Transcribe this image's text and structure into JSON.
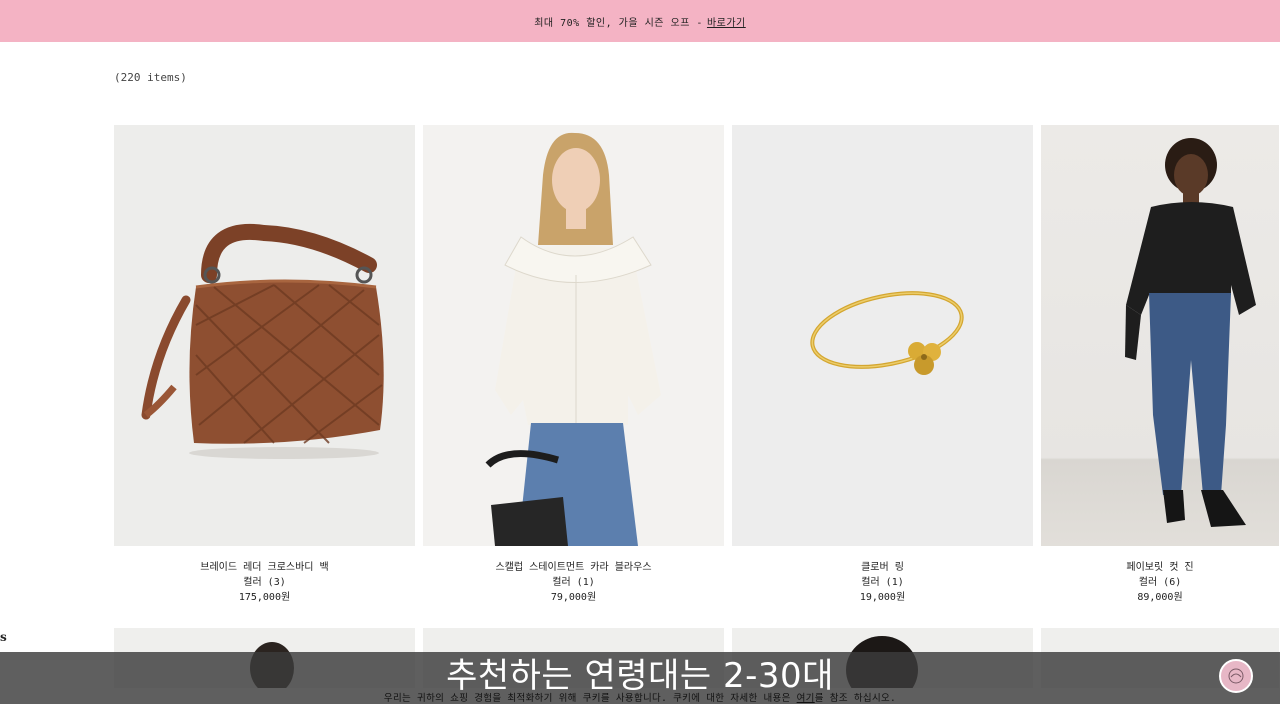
{
  "promo": {
    "text": "최대 70% 할인, 가을 시즌 오프 -",
    "link_label": " 바로가기"
  },
  "listing": {
    "item_count": "(220 items)"
  },
  "edge_glyph": "s",
  "products": [
    {
      "name": "브레이드 레더 크로스바디 백",
      "colors": "컬러 (3)",
      "price": "175,000원",
      "image_icon": "handbag-image"
    },
    {
      "name": "스캘럽 스테이트먼트 카라 블라우스",
      "colors": "컬러 (1)",
      "price": "79,000원",
      "image_icon": "blouse-model-image"
    },
    {
      "name": "클로버 링",
      "colors": "컬러 (1)",
      "price": "19,000원",
      "image_icon": "ring-image"
    },
    {
      "name": "페이보릿 컷 진",
      "colors": "컬러 (6)",
      "price": "89,000원",
      "image_icon": "jeans-model-image"
    }
  ],
  "subtitle": "추천하는 연령대는 2-30대",
  "cookie_notice": {
    "text": "우리는 귀하의 쇼핑 경험을 최적화하기 위해 쿠키를 사용합니다. 쿠키에 대한 자세한 내용은 ",
    "link_label": "여기",
    "suffix": "를 참조 하십시오."
  },
  "colors": {
    "promo_bg": "#f4b3c4",
    "subtitle_bg": "#3c3c3c",
    "page_bg": "#ffffff"
  }
}
